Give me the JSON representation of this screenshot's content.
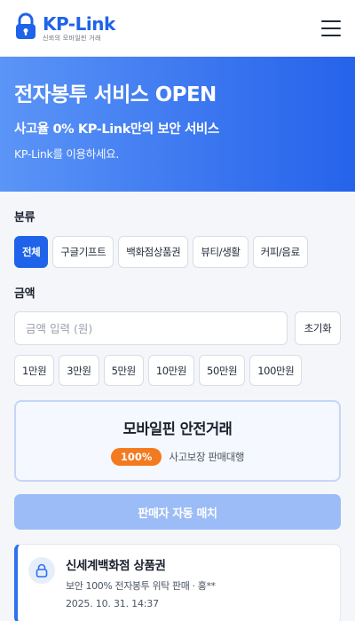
{
  "header": {
    "brand_name": "KP-Link",
    "brand_sub": "신뢰의 모바일핀 거래",
    "logo_icon": "lock-icon",
    "menu_icon": "hamburger-menu-icon"
  },
  "hero": {
    "title": "전자봉투 서비스 OPEN",
    "subtitle": "사고율 0% KP-Link만의 보안 서비스",
    "subtitle2": "KP-Link를 이용하세요."
  },
  "category": {
    "label": "분류",
    "selected": "전체",
    "options": [
      "전체",
      "구글기프트",
      "백화점상품권",
      "뷰티/생활",
      "커피/음료"
    ]
  },
  "amount": {
    "label": "금액",
    "value": "",
    "placeholder": "금액 입력 (원)",
    "reset_label": "초기화",
    "quick": [
      "1만원",
      "3만원",
      "5만원",
      "10만원",
      "50만원",
      "100만원"
    ]
  },
  "safe_trade": {
    "title": "모바일핀 안전거래",
    "badge": "100%",
    "note": "사고보장 판매대행"
  },
  "match_button": {
    "label": "판매자 자동 매치",
    "enabled": false
  },
  "listing": {
    "title": "신세계백화점 상품권",
    "desc": "보안 100% 전자봉투 위탁 판매 · 홍**",
    "date": "2025. 10. 31. 14:37",
    "icon": "lock-icon"
  },
  "colors": {
    "primary": "#1e63e9",
    "accent_orange": "#f47a20",
    "disabled_button": "#9bbcf6"
  }
}
